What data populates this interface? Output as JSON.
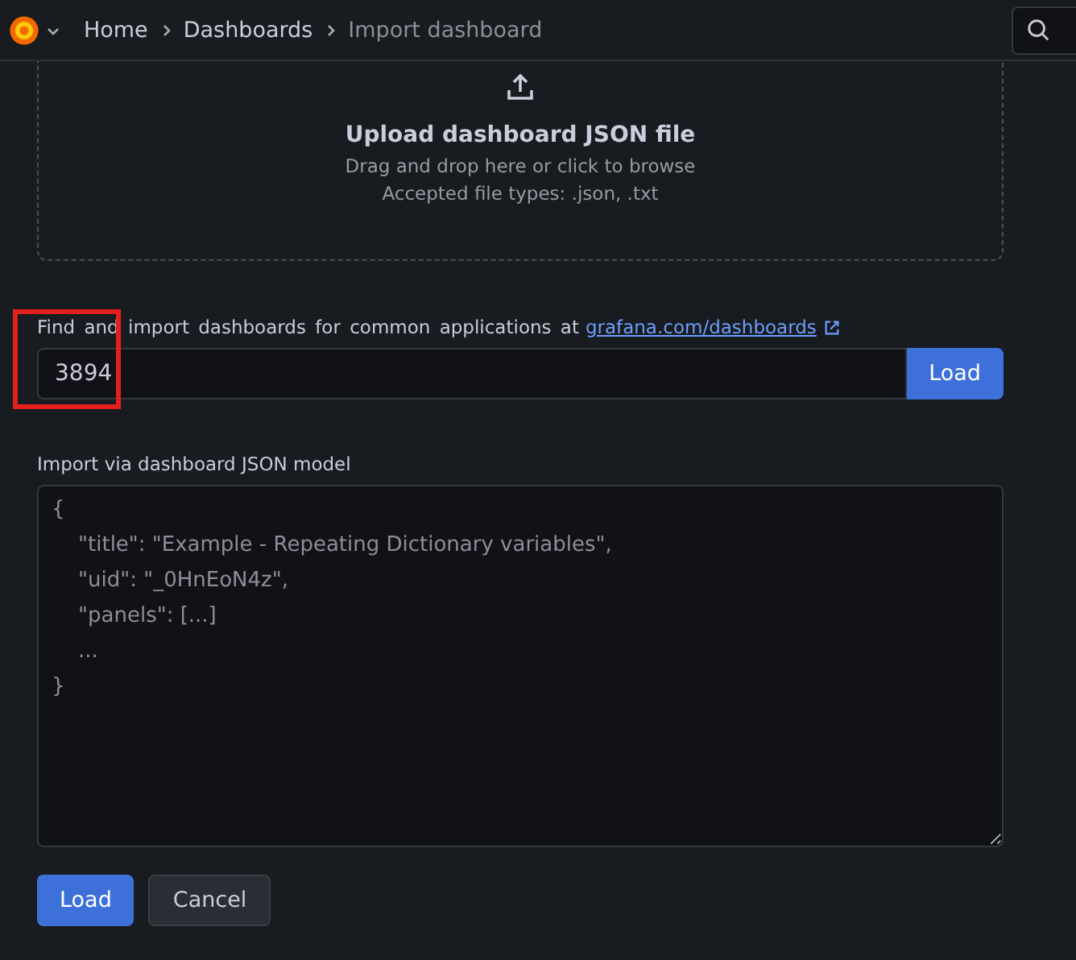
{
  "breadcrumbs": [
    {
      "label": "Home",
      "current": false
    },
    {
      "label": "Dashboards",
      "current": false
    },
    {
      "label": "Import dashboard",
      "current": true
    }
  ],
  "upload": {
    "title": "Upload dashboard JSON file",
    "hint": "Drag and drop here or click to browse",
    "accepted": "Accepted file types: .json, .txt"
  },
  "grafana_import": {
    "label": "Find and import dashboards for common applications at",
    "link": "grafana.com/dashboards",
    "value": "3894",
    "button": "Load"
  },
  "json_model": {
    "label": "Import via dashboard JSON model",
    "placeholder": "{\n    \"title\": \"Example - Repeating Dictionary variables\",\n    \"uid\": \"_0HnEoN4z\",\n    \"panels\": [...]\n    ...\n}"
  },
  "buttons": [
    {
      "label": "Load",
      "kind": "primary"
    },
    {
      "label": "Cancel",
      "kind": "secondary"
    }
  ]
}
